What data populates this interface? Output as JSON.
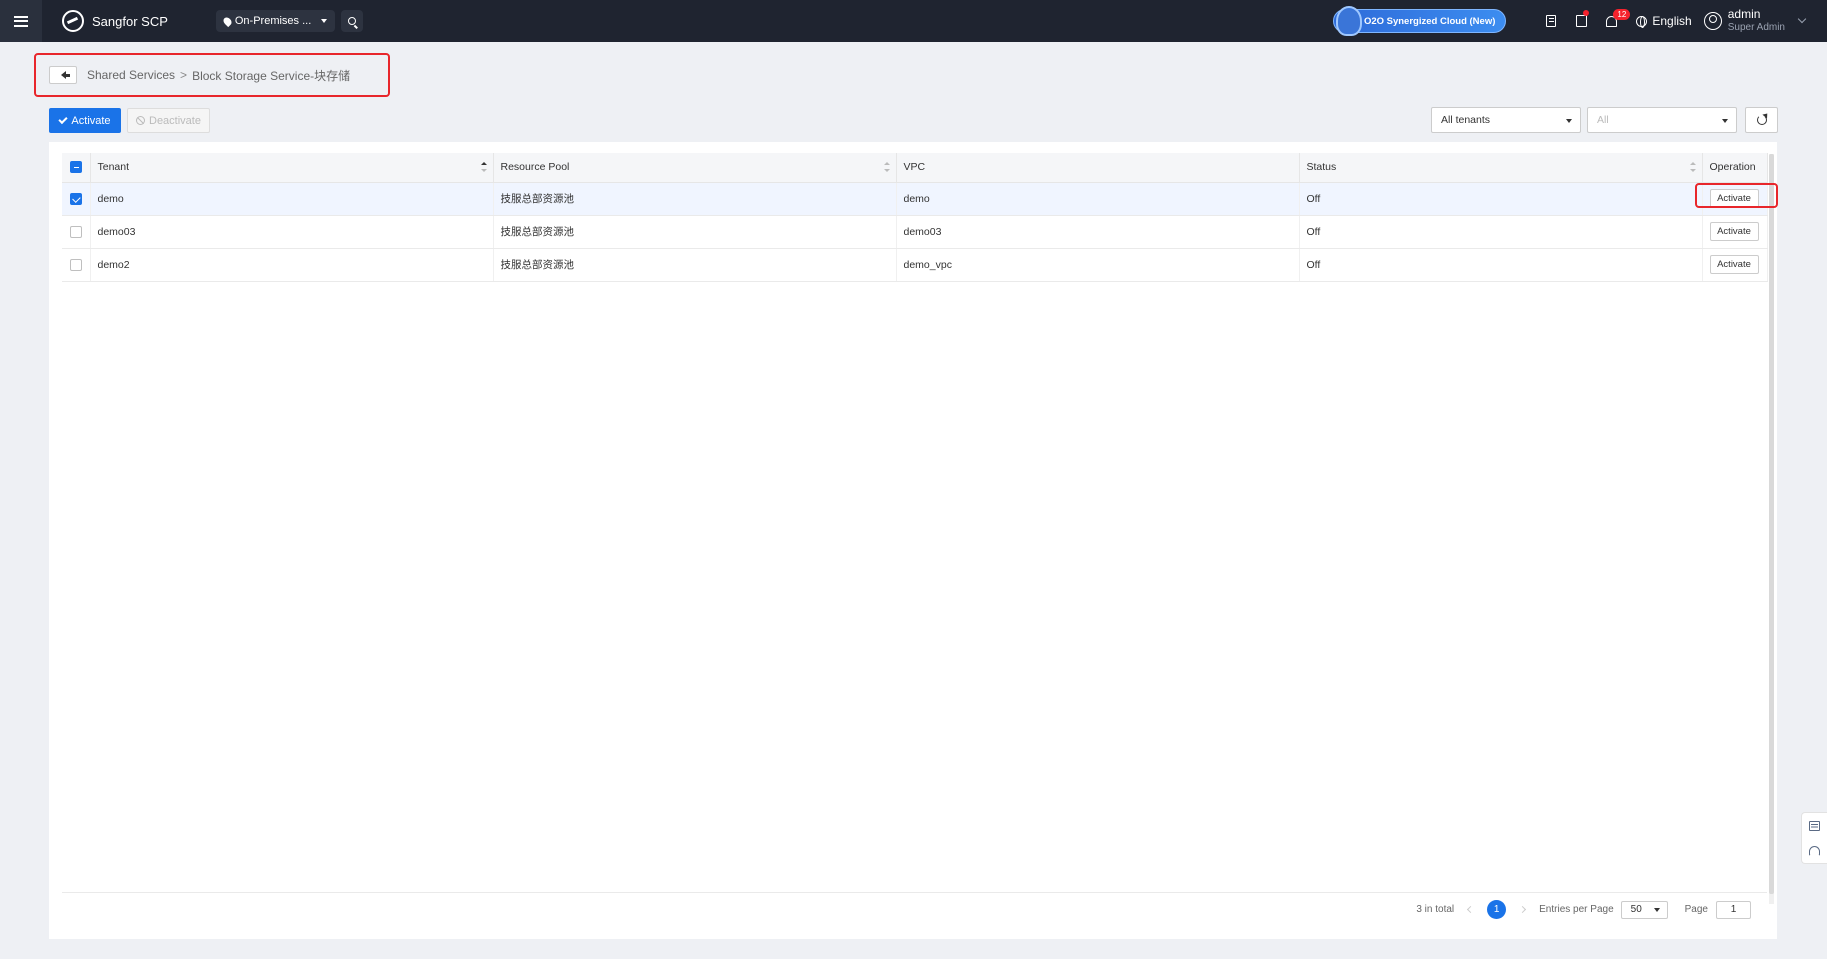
{
  "topbar": {
    "brand": "Sangfor SCP",
    "environment": "On-Premises ...",
    "o2o_label": "O2O Synergized Cloud (New)",
    "notification_count": "12",
    "language": "English",
    "user_name": "admin",
    "user_role": "Super Admin"
  },
  "breadcrumb": {
    "parent": "Shared Services",
    "separator": ">",
    "current": "Block Storage Service-块存储"
  },
  "toolbar": {
    "activate_label": "Activate",
    "deactivate_label": "Deactivate",
    "tenant_filter": "All tenants",
    "second_filter": "All"
  },
  "table": {
    "columns": [
      "Tenant",
      "Resource Pool",
      "VPC",
      "Status",
      "Operation"
    ],
    "rows": [
      {
        "tenant": "demo",
        "resource_pool": "技服总部资源池",
        "vpc": "demo",
        "status": "Off",
        "action": "Activate",
        "checked": true
      },
      {
        "tenant": "demo03",
        "resource_pool": "技服总部资源池",
        "vpc": "demo03",
        "status": "Off",
        "action": "Activate",
        "checked": false
      },
      {
        "tenant": "demo2",
        "resource_pool": "技服总部资源池",
        "vpc": "demo_vpc",
        "status": "Off",
        "action": "Activate",
        "checked": false
      }
    ]
  },
  "pagination": {
    "total_text": "3 in total",
    "current_page": "1",
    "entries_label": "Entries per Page",
    "entries_value": "50",
    "page_label": "Page",
    "page_value": "1"
  },
  "colors": {
    "primary": "#1a73e8",
    "topbar_bg": "#1f2430",
    "highlight": "#e8262b"
  }
}
